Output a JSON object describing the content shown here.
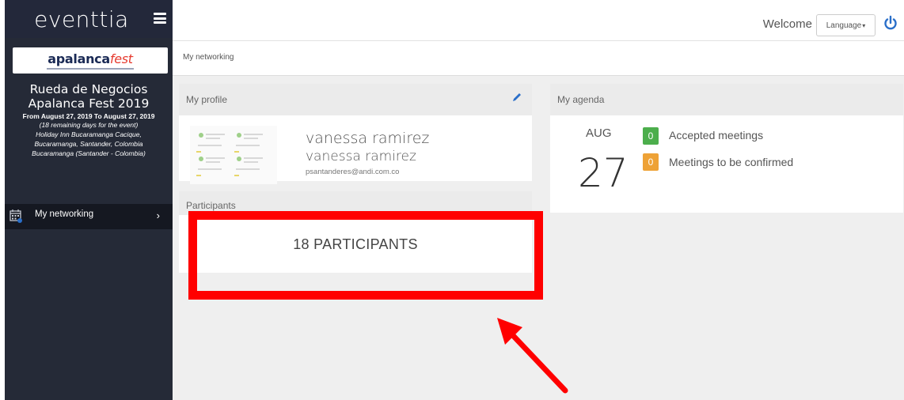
{
  "app": {
    "brand": "eventtia",
    "menu_icon": "hamburger-icon"
  },
  "sidebar": {
    "logo_text_a": "apa",
    "logo_text_b": "lanca",
    "logo_text_c": "fest",
    "event_title_line1": "Rueda de Negocios",
    "event_title_line2": "Apalanca Fest 2019",
    "event_dates": "From August 27, 2019 To August 27, 2019",
    "event_remaining": "(18 remaining days for the event)",
    "event_venue": "Holiday Inn Bucaramanga Cacique,",
    "event_address": "Bucaramanga, Santander, Colombia",
    "event_city": "Bucaramanga (Santander - Colombia)",
    "nav": [
      {
        "label": "My networking",
        "icon": "calendar-icon",
        "chevron": "›"
      }
    ]
  },
  "topbar": {
    "welcome": "Welcome",
    "language_label": "Language",
    "language_caret": "▾",
    "power_icon": "power-icon"
  },
  "breadcrumb": {
    "current": "My networking"
  },
  "profile": {
    "section_title": "My profile",
    "name_line1": "vanessa ramirez",
    "name_line2": "vanessa ramirez",
    "email": "psantanderes@andi.com.co"
  },
  "participants": {
    "section_title": "Participants",
    "count_label": "18 PARTICIPANTS"
  },
  "agenda": {
    "section_title": "My agenda",
    "month": "AUG",
    "day": "27",
    "accepted_count": "0",
    "accepted_label": "Accepted meetings",
    "pending_count": "0",
    "pending_label": "Meetings to be confirmed"
  },
  "colors": {
    "sidebar_bg": "#252a37",
    "accent_blue": "#2a6fc9",
    "badge_green": "#4cae4c",
    "badge_orange": "#eea236",
    "annotation_red": "#ff0000"
  }
}
